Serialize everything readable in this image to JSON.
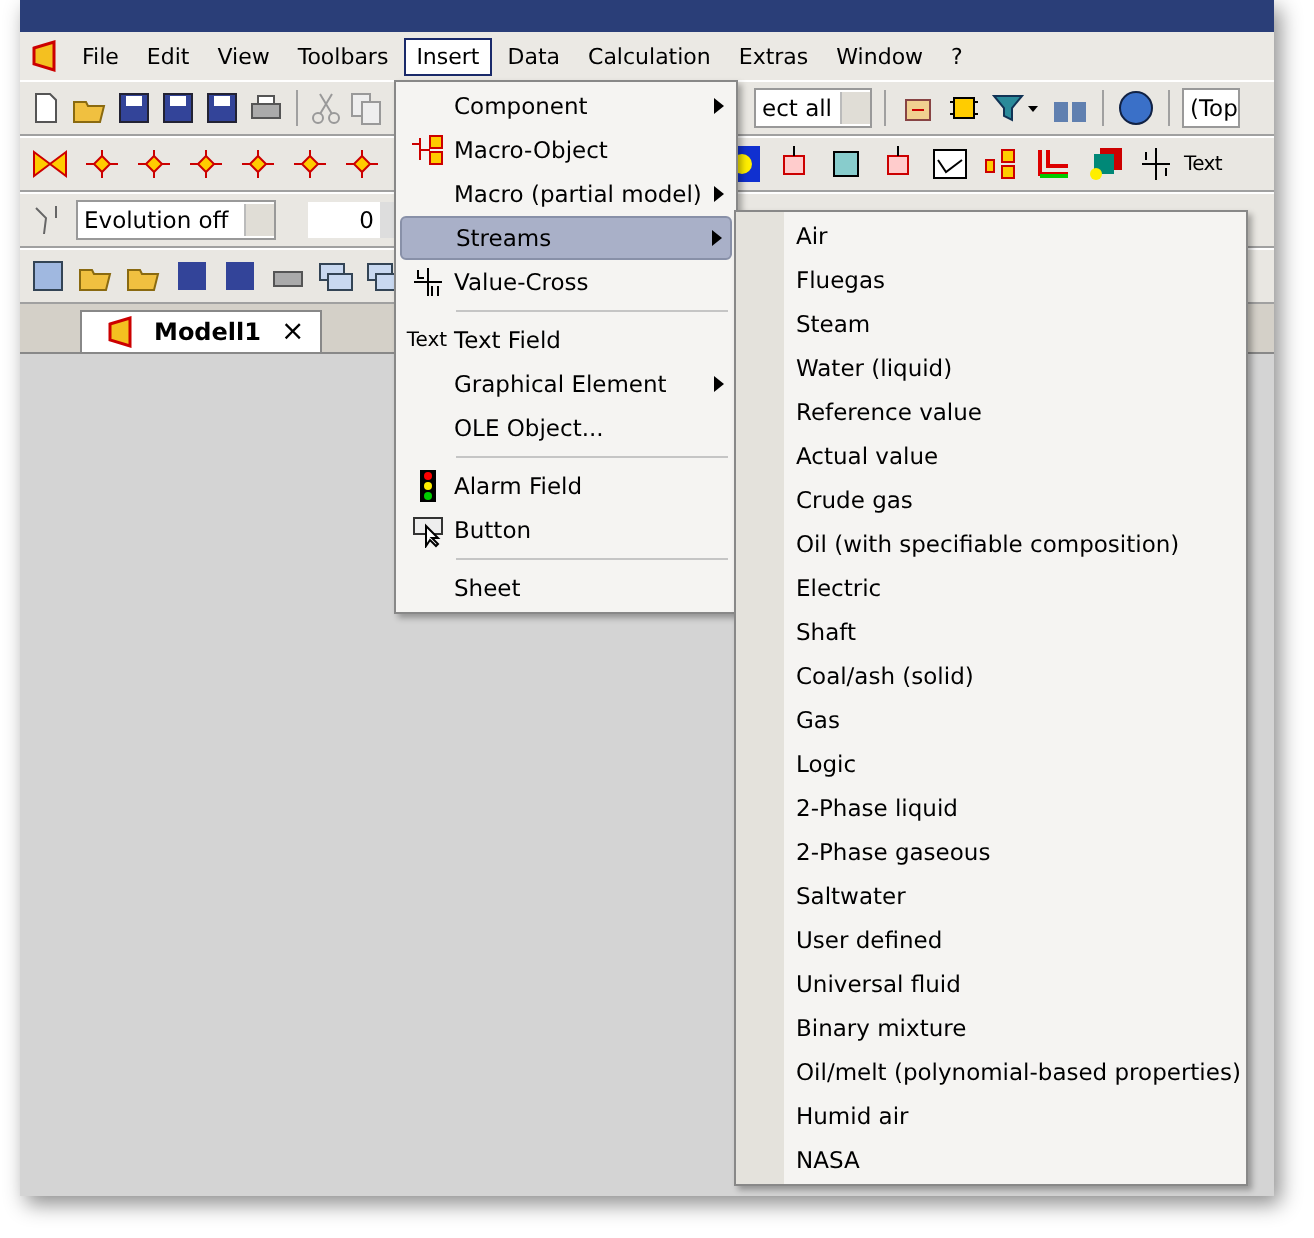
{
  "menu_bar": [
    {
      "label": "File",
      "selected": false
    },
    {
      "label": "Edit",
      "selected": false
    },
    {
      "label": "View",
      "selected": false
    },
    {
      "label": "Toolbars",
      "selected": false
    },
    {
      "label": "Insert",
      "selected": true
    },
    {
      "label": "Data",
      "selected": false
    },
    {
      "label": "Calculation",
      "selected": false
    },
    {
      "label": "Extras",
      "selected": false
    },
    {
      "label": "Window",
      "selected": false
    },
    {
      "label": "?",
      "selected": false
    }
  ],
  "toolbar": {
    "select_combo": "ect all",
    "view_combo": "(Top",
    "text_tool": "Text",
    "evolution_combo": "Evolution off",
    "spin_value": "0"
  },
  "tabs": [
    {
      "label": "Modell1",
      "close": "×",
      "selected": true
    }
  ],
  "insert_menu": [
    {
      "kind": "item",
      "label": "Component",
      "submenu": true,
      "highlighted": false
    },
    {
      "kind": "item",
      "label": "Macro-Object",
      "submenu": false,
      "highlighted": false
    },
    {
      "kind": "item",
      "label": "Macro (partial model)",
      "submenu": true,
      "highlighted": false
    },
    {
      "kind": "item",
      "label": "Streams",
      "submenu": true,
      "highlighted": true
    },
    {
      "kind": "item",
      "label": "Value-Cross",
      "submenu": false,
      "highlighted": false
    },
    {
      "kind": "separator"
    },
    {
      "kind": "item",
      "label": "Text Field",
      "submenu": false,
      "highlighted": false,
      "icon_label": "Text"
    },
    {
      "kind": "item",
      "label": "Graphical Element",
      "submenu": true,
      "highlighted": false
    },
    {
      "kind": "item",
      "label": "OLE Object...",
      "submenu": false,
      "highlighted": false
    },
    {
      "kind": "separator"
    },
    {
      "kind": "item",
      "label": "Alarm Field",
      "submenu": false,
      "highlighted": false
    },
    {
      "kind": "item",
      "label": "Button",
      "submenu": false,
      "highlighted": false
    },
    {
      "kind": "separator"
    },
    {
      "kind": "item",
      "label": "Sheet",
      "submenu": false,
      "highlighted": false
    }
  ],
  "streams_menu": [
    "Air",
    "Fluegas",
    "Steam",
    "Water (liquid)",
    "Reference value",
    "Actual value",
    "Crude gas",
    "Oil (with specifiable composition)",
    "Electric",
    "Shaft",
    "Coal/ash (solid)",
    "Gas",
    "Logic",
    "2-Phase liquid",
    "2-Phase gaseous",
    "Saltwater",
    "User defined",
    "Universal fluid",
    "Binary mixture",
    "Oil/melt (polynomial-based properties)",
    "Humid air",
    "NASA"
  ]
}
